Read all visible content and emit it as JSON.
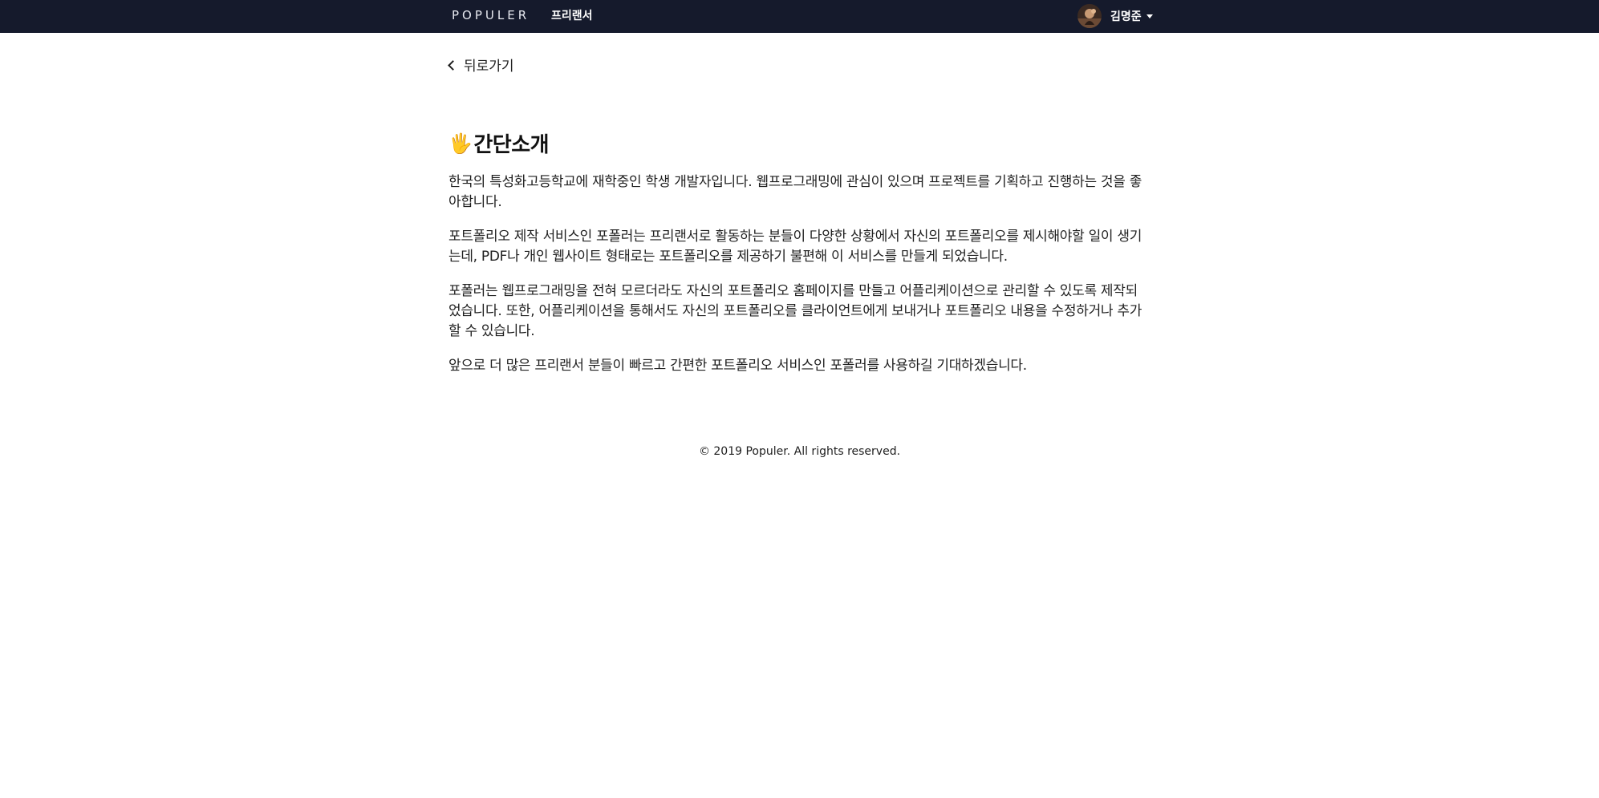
{
  "navbar": {
    "logo_text": "POPULER",
    "nav_link": "프리랜서",
    "user_name": "김명준"
  },
  "back": {
    "label": "뒤로가기"
  },
  "intro": {
    "emoji": "🖐",
    "title": "간단소개",
    "paragraphs": [
      "한국의 특성화고등학교에 재학중인 학생 개발자입니다. 웹프로그래밍에 관심이 있으며 프로젝트를 기획하고 진행하는 것을 좋아합니다.",
      "포트폴리오 제작 서비스인 포폴러는 프리랜서로 활동하는 분들이 다양한 상황에서 자신의 포트폴리오를 제시해야할 일이 생기는데, PDF나 개인 웹사이트 형태로는 포트폴리오를 제공하기 불편해 이 서비스를 만들게 되었습니다.",
      "포폴러는 웹프로그래밍을 전혀 모르더라도 자신의 포트폴리오 홈페이지를 만들고 어플리케이션으로 관리할 수 있도록 제작되었습니다. 또한, 어플리케이션을 통해서도 자신의 포트폴리오를 클라이언트에게 보내거나 포트폴리오 내용을 수정하거나 추가할 수 있습니다.",
      "앞으로 더 많은 프리랜서 분들이 빠르고 간편한 포트폴리오 서비스인 포폴러를 사용하길 기대하겠습니다."
    ]
  },
  "footer": {
    "copyright": "© 2019 Populer. All rights reserved."
  },
  "colors": {
    "navbar_bg": "#151a2c",
    "text": "#1f1f1f"
  }
}
